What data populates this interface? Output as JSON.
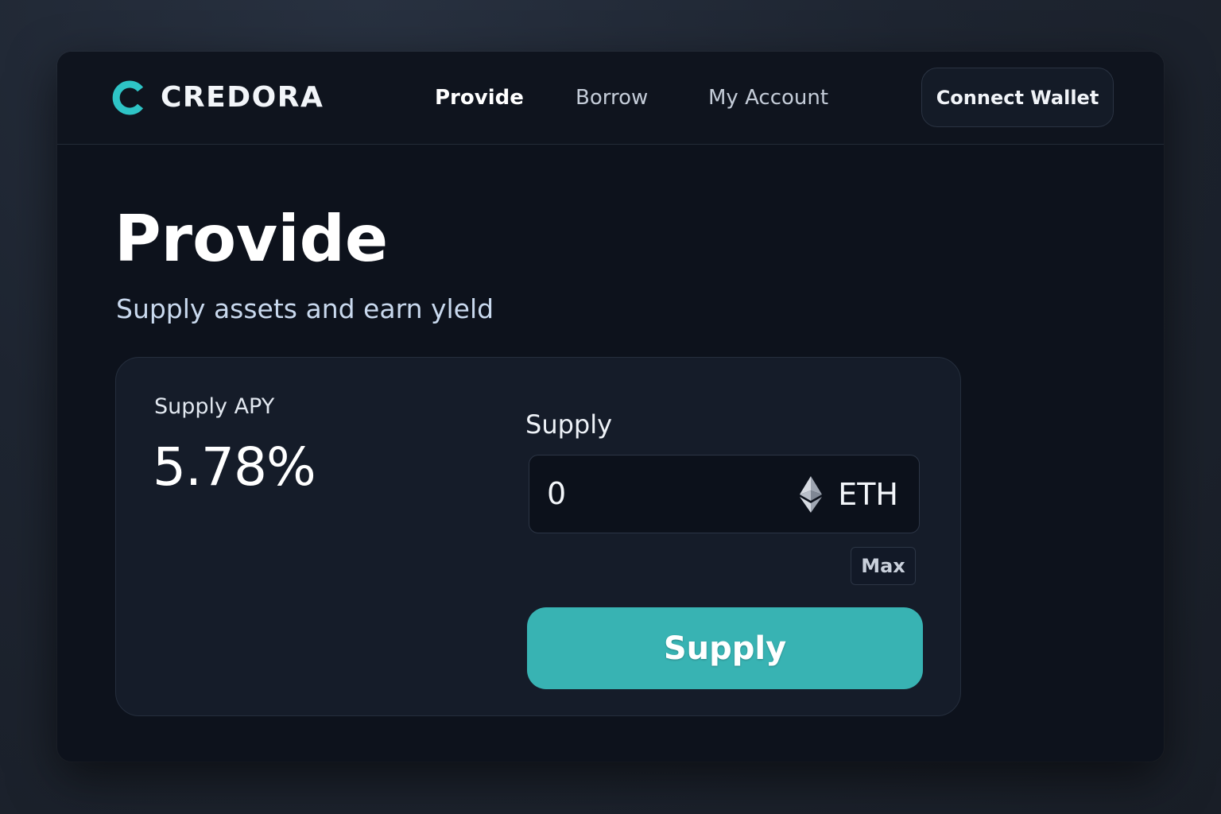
{
  "brand": {
    "name": "CREDORA",
    "accent_color": "#38b3b3",
    "logo_icon": "credora-c-logo"
  },
  "nav": {
    "items": [
      {
        "label": "Provide",
        "active": true
      },
      {
        "label": "Borrow",
        "active": false
      },
      {
        "label": "My Account",
        "active": false
      }
    ],
    "connect_wallet_label": "Connect Wallet"
  },
  "page": {
    "title": "Provide",
    "subtitle": "Supply assets and earn yleld"
  },
  "market": {
    "apy_label": "Supply APY",
    "apy_value": "5.78%"
  },
  "supply_form": {
    "label": "Supply",
    "amount_value": "0",
    "asset_symbol": "ETH",
    "asset_icon": "ethereum-icon",
    "max_label": "Max",
    "submit_label": "Supply"
  }
}
